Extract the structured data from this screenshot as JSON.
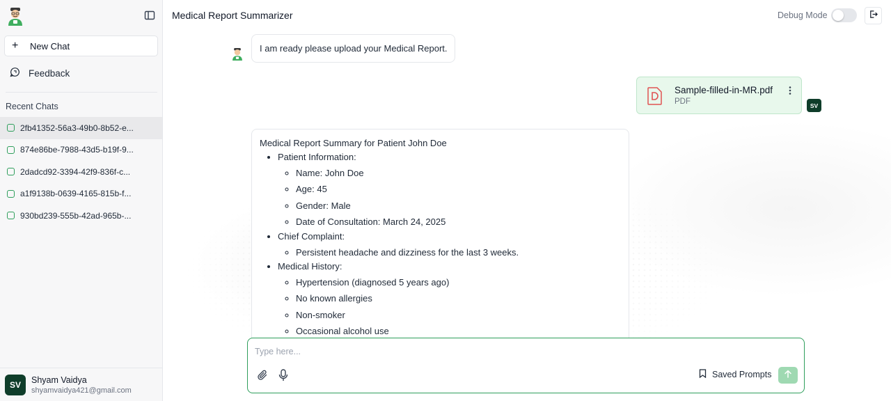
{
  "app": {
    "title": "Medical Report Summarizer",
    "debug_label": "Debug Mode",
    "debug_enabled": false
  },
  "sidebar": {
    "new_chat_label": "New Chat",
    "feedback_label": "Feedback",
    "recent_title": "Recent Chats",
    "chats": [
      "2fb41352-56a3-49b0-8b52-e...",
      "874e86be-7988-43d5-b19f-9...",
      "2dadcd92-3394-42f9-836f-c...",
      "a1f9138b-0639-4165-815b-f...",
      "930bd239-555b-42ad-965b-..."
    ],
    "user": {
      "initials": "SV",
      "name": "Shyam Vaidya",
      "email": "shyamvaidya421@gmail.com"
    }
  },
  "messages": {
    "greeting": "I am ready please upload your Medical Report.",
    "file": {
      "name": "Sample-filled-in-MR.pdf",
      "type": "PDF"
    },
    "user_initials": "SV",
    "summary": {
      "heading": "Medical Report Summary for Patient John Doe",
      "sections": [
        {
          "title": "Patient Information:",
          "items": [
            "Name: John Doe",
            "Age: 45",
            "Gender: Male",
            "Date of Consultation: March 24, 2025"
          ]
        },
        {
          "title": "Chief Complaint:",
          "items": [
            "Persistent headache and dizziness for the last 3 weeks."
          ]
        },
        {
          "title": "Medical History:",
          "items": [
            "Hypertension (diagnosed 5 years ago)",
            "No known allergies",
            "Non-smoker",
            "Occasional alcohol use"
          ]
        }
      ]
    }
  },
  "composer": {
    "placeholder": "Type here...",
    "saved_prompts_label": "Saved Prompts"
  },
  "colors": {
    "accent": "#2e9e5b",
    "avatar_bg": "#0f3d2a",
    "file_card_bg": "#e8f8ec",
    "send_disabled": "#9fd9b2",
    "pdf_red": "#e05252"
  },
  "icons": {
    "logo": "doctor-mascot-icon",
    "toggle": "sidebar-toggle-icon",
    "new_chat": "plus-icon",
    "feedback": "feedback-icon",
    "logout": "logout-icon",
    "pdf": "pdf-file-icon",
    "menu": "kebab-menu-icon",
    "attach": "paperclip-icon",
    "mic": "microphone-icon",
    "bookmark": "bookmark-icon",
    "send": "send-arrow-icon"
  }
}
